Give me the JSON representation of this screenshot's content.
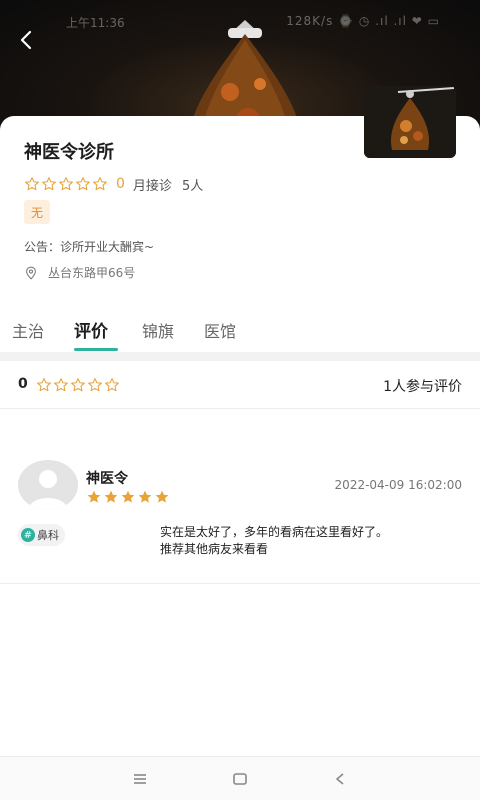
{
  "status_bar": {
    "time": "上午11:36",
    "right": "128K/s ⌚ ◷ .ıl .ıl ❤ ▭"
  },
  "clinic": {
    "name": "神医令诊所",
    "rating_score": "0",
    "month_label": "月接诊",
    "month_count": "5人",
    "tag": "无",
    "notice": "公告：诊所开业大酬宾~",
    "address": "丛台东路甲66号"
  },
  "tabs": [
    {
      "label": "主治"
    },
    {
      "label": "评价"
    },
    {
      "label": "锦旗"
    },
    {
      "label": "医馆"
    }
  ],
  "active_tab": "评价",
  "review_summary": {
    "score": "0",
    "participants": "1人参与评价"
  },
  "reviews": [
    {
      "name": "神医令",
      "stars": 5,
      "time": "2022-04-09 16:02:00",
      "department": "鼻科",
      "text_line1": "实在是太好了，多年的看病在这里看好了。",
      "text_line2": "推荐其他病友来看看"
    }
  ],
  "icons": {
    "back": "back-arrow-icon",
    "pin": "location-pin-icon",
    "star_empty": "star-outline-icon",
    "star_full": "star-filled-icon"
  },
  "colors": {
    "accent": "#2bb3a0",
    "star": "#e8a33a",
    "tag_bg": "#fdeedd",
    "tag_text": "#e88a32"
  }
}
